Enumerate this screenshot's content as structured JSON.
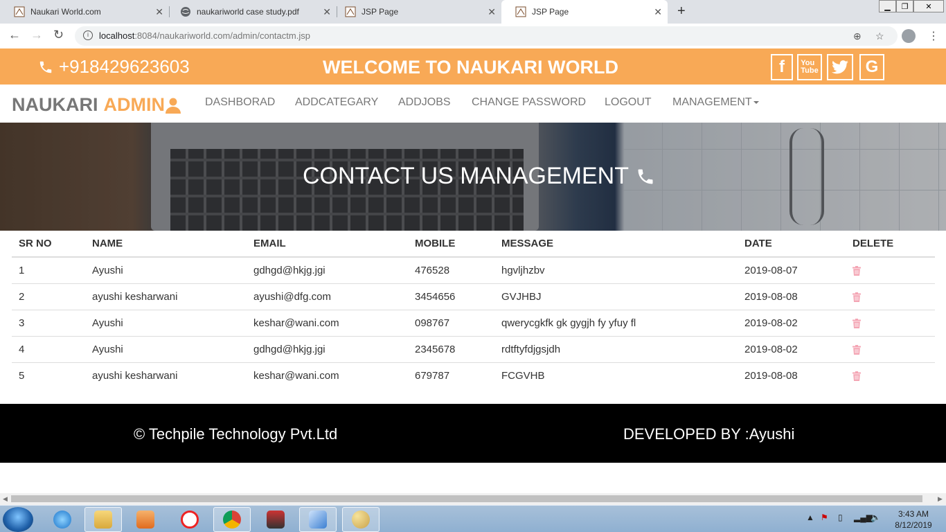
{
  "browser": {
    "tabs": [
      {
        "title": "Naukari World.com",
        "active": false
      },
      {
        "title": "naukariworld case study.pdf",
        "active": false
      },
      {
        "title": "JSP Page",
        "active": false
      },
      {
        "title": "JSP Page",
        "active": true
      }
    ],
    "url_host": "localhost",
    "url_rest": ":8084/naukariworld.com/admin/contactm.jsp"
  },
  "topbar": {
    "phone": "+918429623603",
    "welcome": "WELCOME TO NAUKARI WORLD",
    "social": [
      "facebook-icon",
      "youtube-icon",
      "twitter-icon",
      "google-icon"
    ]
  },
  "nav": {
    "brand_left": "NAUKARI",
    "brand_right": "ADMIN",
    "links": [
      "DASHBORAD",
      "ADDCATEGARY",
      "ADDJOBS",
      "CHANGE PASSWORD",
      "LOGOUT",
      "MANAGEMENT"
    ]
  },
  "banner": {
    "title": "CONTACT US MANAGEMENT"
  },
  "table": {
    "headers": [
      "SR NO",
      "NAME",
      "EMAIL",
      "MOBILE",
      "MESSAGE",
      "DATE",
      "DELETE"
    ],
    "rows": [
      [
        "1",
        "Ayushi",
        "gdhgd@hkjg.jgi",
        "476528",
        "hgvljhzbv",
        "2019-08-07"
      ],
      [
        "2",
        "ayushi kesharwani",
        "ayushi@dfg.com",
        "3454656",
        "GVJHBJ",
        "2019-08-08"
      ],
      [
        "3",
        "Ayushi",
        "keshar@wani.com",
        "098767",
        "qwerycgkfk gk gygjh fy yfuy fl",
        "2019-08-02"
      ],
      [
        "4",
        "Ayushi",
        "gdhgd@hkjg.jgi",
        "2345678",
        "rdtftyfdjgsjdh",
        "2019-08-02"
      ],
      [
        "5",
        "ayushi kesharwani",
        "keshar@wani.com",
        "679787",
        "FCGVHB",
        "2019-08-08"
      ]
    ]
  },
  "footer": {
    "copyright": "© Techpile Technology Pvt.Ltd",
    "developer": "DEVELOPED BY :Ayushi"
  },
  "taskbar": {
    "time": "3:43 AM",
    "date": "8/12/2019"
  },
  "colors": {
    "accent": "#f8a956",
    "delete_icon": "#f4a5b4"
  }
}
